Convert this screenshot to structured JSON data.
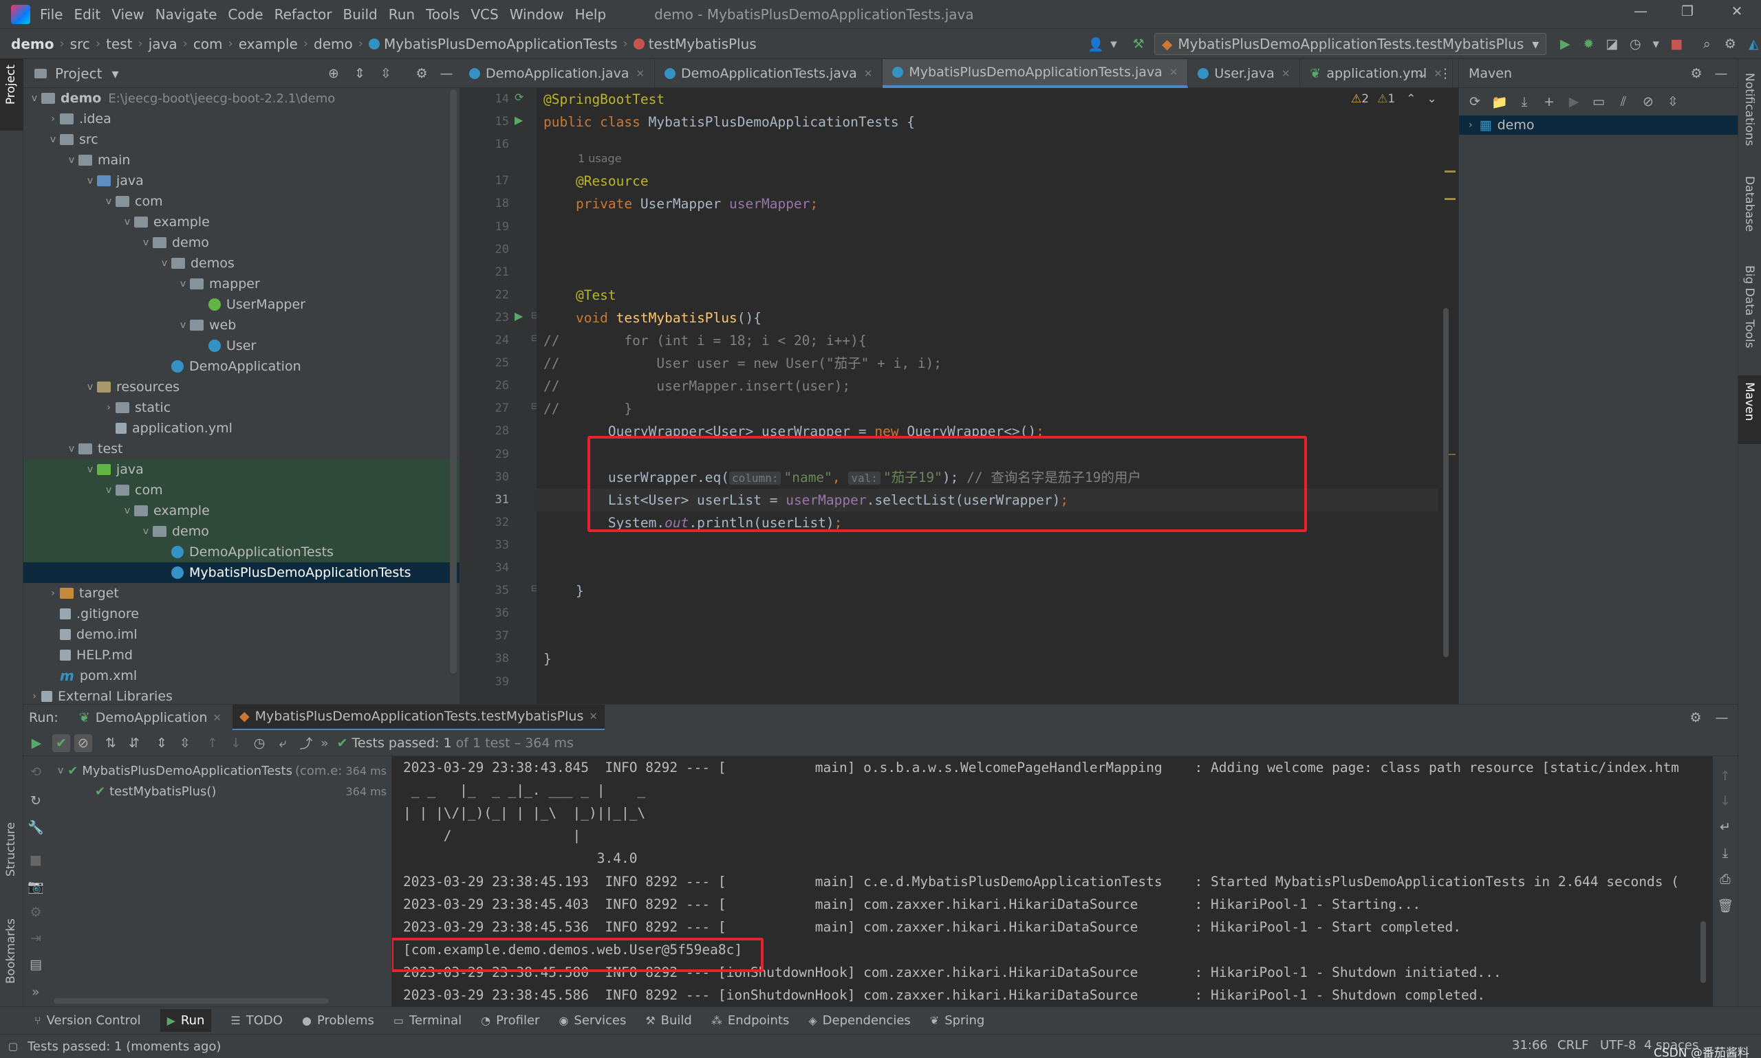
{
  "menubar": {
    "items": [
      "File",
      "Edit",
      "View",
      "Navigate",
      "Code",
      "Refactor",
      "Build",
      "Run",
      "Tools",
      "VCS",
      "Window",
      "Help"
    ],
    "title": "demo - MybatisPlusDemoApplicationTests.java"
  },
  "breadcrumb": [
    "demo",
    "src",
    "test",
    "java",
    "com",
    "example",
    "demo",
    "MybatisPlusDemoApplicationTests",
    "testMybatisPlus"
  ],
  "run_config": "MybatisPlusDemoApplicationTests.testMybatisPlus",
  "left_stripe": {
    "project": "Project",
    "structure": "Structure",
    "bookmarks": "Bookmarks"
  },
  "right_stripe": {
    "notifications": "Notifications",
    "database": "Database",
    "bigdata": "Big Data Tools",
    "maven": "Maven"
  },
  "project_panel": {
    "title": "Project"
  },
  "tree": [
    {
      "label": "demo",
      "path": "E:\\jeecg-boot\\jeecg-boot-2.2.1\\demo",
      "depth": 0,
      "arrow": "v",
      "icon": "folder"
    },
    {
      "label": ".idea",
      "depth": 1,
      "arrow": ">",
      "icon": "folder"
    },
    {
      "label": "src",
      "depth": 1,
      "arrow": "v",
      "icon": "folder"
    },
    {
      "label": "main",
      "depth": 2,
      "arrow": "v",
      "icon": "folder"
    },
    {
      "label": "java",
      "depth": 3,
      "arrow": "v",
      "icon": "folder src"
    },
    {
      "label": "com",
      "depth": 4,
      "arrow": "v",
      "icon": "folder"
    },
    {
      "label": "example",
      "depth": 5,
      "arrow": "v",
      "icon": "folder"
    },
    {
      "label": "demo",
      "depth": 6,
      "arrow": "v",
      "icon": "folder"
    },
    {
      "label": "demos",
      "depth": 7,
      "arrow": "v",
      "icon": "folder"
    },
    {
      "label": "mapper",
      "depth": 8,
      "arrow": "v",
      "icon": "folder"
    },
    {
      "label": "UserMapper",
      "depth": 9,
      "arrow": "",
      "icon": "jint"
    },
    {
      "label": "web",
      "depth": 8,
      "arrow": "v",
      "icon": "folder"
    },
    {
      "label": "User",
      "depth": 9,
      "arrow": "",
      "icon": "jcls"
    },
    {
      "label": "DemoApplication",
      "depth": 7,
      "arrow": "",
      "icon": "jcls"
    },
    {
      "label": "resources",
      "depth": 3,
      "arrow": "v",
      "icon": "folder res"
    },
    {
      "label": "static",
      "depth": 4,
      "arrow": ">",
      "icon": "folder"
    },
    {
      "label": "application.yml",
      "depth": 4,
      "arrow": "",
      "icon": "fyml"
    },
    {
      "label": "test",
      "depth": 2,
      "arrow": "v",
      "icon": "folder"
    },
    {
      "label": "java",
      "depth": 3,
      "arrow": "v",
      "icon": "folder test",
      "hl": true
    },
    {
      "label": "com",
      "depth": 4,
      "arrow": "v",
      "icon": "folder",
      "hl": true
    },
    {
      "label": "example",
      "depth": 5,
      "arrow": "v",
      "icon": "folder",
      "hl": true
    },
    {
      "label": "demo",
      "depth": 6,
      "arrow": "v",
      "icon": "folder",
      "hl": true
    },
    {
      "label": "DemoApplicationTests",
      "depth": 7,
      "arrow": "",
      "icon": "jcls",
      "hl": true
    },
    {
      "label": "MybatisPlusDemoApplicationTests",
      "depth": 7,
      "arrow": "",
      "icon": "jcls",
      "sel": true
    },
    {
      "label": "target",
      "depth": 1,
      "arrow": ">",
      "icon": "folder excl"
    },
    {
      "label": ".gitignore",
      "depth": 1,
      "arrow": "",
      "icon": "fyml"
    },
    {
      "label": "demo.iml",
      "depth": 1,
      "arrow": "",
      "icon": "fyml"
    },
    {
      "label": "HELP.md",
      "depth": 1,
      "arrow": "",
      "icon": "fyml"
    },
    {
      "label": "pom.xml",
      "depth": 1,
      "arrow": "",
      "icon": "fyml",
      "prefix": "m"
    },
    {
      "label": "External Libraries",
      "depth": 0,
      "arrow": ">",
      "icon": "fyml"
    }
  ],
  "tabs": [
    {
      "label": "DemoApplication.java",
      "active": false
    },
    {
      "label": "DemoApplicationTests.java",
      "active": false
    },
    {
      "label": "MybatisPlusDemoApplicationTests.java",
      "active": true
    },
    {
      "label": "User.java",
      "active": false
    },
    {
      "label": "application.yml",
      "active": false
    }
  ],
  "editor": {
    "warnings": "2",
    "weak_warnings": "1",
    "line_numbers": [
      "14",
      "15",
      "16",
      "17",
      "18",
      "19",
      "20",
      "21",
      "22",
      "23",
      "24",
      "25",
      "26",
      "27",
      "28",
      "29",
      "30",
      "31",
      "32",
      "33",
      "34",
      "35",
      "36",
      "37",
      "38",
      "39"
    ],
    "current_line": "31",
    "usage_hint": "1 usage",
    "lines": [
      [
        {
          "t": "@SpringBootTest",
          "c": "ann"
        }
      ],
      [
        {
          "t": "public class ",
          "c": "kw"
        },
        {
          "t": "MybatisPlusDemoApplicationTests {",
          "c": ""
        }
      ],
      [],
      [
        {
          "t": "    @Resource",
          "c": "ann"
        }
      ],
      [
        {
          "t": "    private ",
          "c": "kw"
        },
        {
          "t": "UserMapper ",
          "c": ""
        },
        {
          "t": "userMapper",
          "c": "fld"
        },
        {
          "t": ";",
          "c": "kw"
        }
      ],
      [],
      [],
      [],
      [
        {
          "t": "    @Test",
          "c": "ann"
        }
      ],
      [
        {
          "t": "    void ",
          "c": "kw"
        },
        {
          "t": "testMybatisPlus",
          "c": "fn"
        },
        {
          "t": "(){",
          "c": ""
        }
      ],
      [
        {
          "t": "//        for (int i = 18; i < 20; i++){",
          "c": "cmt"
        }
      ],
      [
        {
          "t": "//            User user = new User(\"茄子\" + i, i);",
          "c": "cmt"
        }
      ],
      [
        {
          "t": "//            userMapper.insert(user);",
          "c": "cmt"
        }
      ],
      [
        {
          "t": "//        }",
          "c": "cmt"
        }
      ],
      [
        {
          "t": "        QueryWrapper<User> userWrapper = ",
          "c": ""
        },
        {
          "t": "new ",
          "c": "kw"
        },
        {
          "t": "QueryWrapper<>()",
          "c": ""
        },
        {
          "t": ";",
          "c": "kw"
        }
      ],
      [],
      [
        {
          "t": "        userWrapper.eq(",
          "c": ""
        },
        {
          "t": "column:",
          "c": "hint"
        },
        {
          "t": "\"name\"",
          "c": "str"
        },
        {
          "t": ", ",
          "c": "kw"
        },
        {
          "t": "val:",
          "c": "hint"
        },
        {
          "t": "\"茄子19\"",
          "c": "str"
        },
        {
          "t": "); ",
          "c": ""
        },
        {
          "t": "// 查询名字是茄子19的用户",
          "c": "cmt"
        }
      ],
      [
        {
          "t": "        List<User> userList = ",
          "c": ""
        },
        {
          "t": "userMapper",
          "c": "fld"
        },
        {
          "t": ".selectList(userWrapper)",
          "c": ""
        },
        {
          "t": ";",
          "c": "kw"
        }
      ],
      [
        {
          "t": "        System.",
          "c": ""
        },
        {
          "t": "out",
          "c": "st"
        },
        {
          "t": ".println(userList)",
          "c": ""
        },
        {
          "t": ";",
          "c": "kw"
        }
      ],
      [],
      [],
      [
        {
          "t": "    }",
          "c": ""
        }
      ],
      [],
      [],
      [
        {
          "t": "}",
          "c": ""
        }
      ],
      []
    ]
  },
  "maven": {
    "title": "Maven",
    "root": "demo"
  },
  "run": {
    "label": "Run:",
    "tabs": [
      "DemoApplication",
      "MybatisPlusDemoApplicationTests.testMybatisPlus"
    ],
    "status": "Tests passed:",
    "status_count": "1",
    "status_rest": "of 1 test – 364 ms"
  },
  "test_tree": [
    {
      "label": "MybatisPlusDemoApplicationTests",
      "pkg": "(com.e:",
      "time": "364 ms"
    },
    {
      "label": "testMybatisPlus()",
      "time": "364 ms"
    }
  ],
  "console": [
    "2023-03-29 23:38:43.845  INFO 8292 --- [           main] o.s.b.a.w.s.WelcomePageHandlerMapping    : Adding welcome page: class path resource [static/index.htm",
    " _ _   |_  _ _|_. ___ _ |    _ ",
    "| | |\\/|_)(_| | |_\\  |_)||_|_\\ ",
    "     /               |         ",
    "                        3.4.0 ",
    "2023-03-29 23:38:45.193  INFO 8292 --- [           main] c.e.d.MybatisPlusDemoApplicationTests    : Started MybatisPlusDemoApplicationTests in 2.644 seconds (",
    "2023-03-29 23:38:45.403  INFO 8292 --- [           main] com.zaxxer.hikari.HikariDataSource       : HikariPool-1 - Starting...",
    "2023-03-29 23:38:45.536  INFO 8292 --- [           main] com.zaxxer.hikari.HikariDataSource       : HikariPool-1 - Start completed.",
    "[com.example.demo.demos.web.User@5f59ea8c]",
    "2023-03-29 23:38:45.580  INFO 8292 --- [ionShutdownHook] com.zaxxer.hikari.HikariDataSource       : HikariPool-1 - Shutdown initiated...",
    "2023-03-29 23:38:45.586  INFO 8292 --- [ionShutdownHook] com.zaxxer.hikari.HikariDataSource       : HikariPool-1 - Shutdown completed."
  ],
  "bottom_tools": [
    {
      "label": "Version Control",
      "icon": "⑂"
    },
    {
      "label": "Run",
      "icon": "▶"
    },
    {
      "label": "TODO",
      "icon": "☰"
    },
    {
      "label": "Problems",
      "icon": "●"
    },
    {
      "label": "Terminal",
      "icon": "▭"
    },
    {
      "label": "Profiler",
      "icon": "◔"
    },
    {
      "label": "Services",
      "icon": "◉"
    },
    {
      "label": "Build",
      "icon": "⚒"
    },
    {
      "label": "Endpoints",
      "icon": "⁂"
    },
    {
      "label": "Dependencies",
      "icon": "◈"
    },
    {
      "label": "Spring",
      "icon": "❦"
    }
  ],
  "status": {
    "message": "Tests passed: 1 (moments ago)",
    "position": "31:66",
    "line_sep": "CRLF",
    "encoding": "UTF-8",
    "indent": "4 spaces",
    "watermark": "CSDN @番茄酱料"
  },
  "colors": {
    "accent": "#4a88c7",
    "redbox": "#e8222a",
    "pass": "#59a869"
  }
}
